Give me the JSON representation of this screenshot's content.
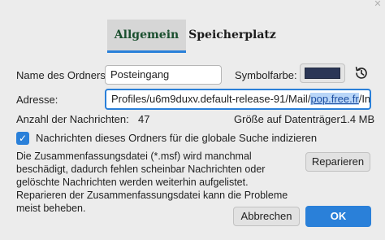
{
  "tabs": [
    {
      "label": "Allgemein",
      "selected": true
    },
    {
      "label": "Speicherplatz",
      "selected": false
    }
  ],
  "folder_name": {
    "label": "Name des Ordners:",
    "value": "Posteingang"
  },
  "symbol_color": {
    "label": "Symbolfarbe:",
    "color": "#2b3656",
    "reset_icon": "history-reset-icon"
  },
  "address": {
    "label": "Adresse:",
    "value_before": "Profiles/u6m9duxv.default-release-91/Mail/",
    "value_selected": "pop.free.fr",
    "value_after": "/Inbox"
  },
  "message_count": {
    "label": "Anzahl der Nachrichten:",
    "value": "47"
  },
  "disk_size": {
    "label": "Größe auf Datenträger:",
    "value": "1.4 MB"
  },
  "global_search": {
    "label": "Nachrichten dieses Ordners für die globale Suche indizieren",
    "checked": true
  },
  "repair": {
    "description": "Die Zusammenfassungsdatei (*.msf) wird manchmal beschädigt, dadurch fehlen scheinbar Nachrichten oder gelöschte Nachrichten werden weiterhin aufgelistet. Reparieren der Zusammenfassungsdatei kann die Probleme meist beheben.",
    "button_label": "Reparieren"
  },
  "footer": {
    "cancel_label": "Abbrechen",
    "ok_label": "OK"
  },
  "colors": {
    "accent": "#2a80d9",
    "background": "#ececec"
  }
}
